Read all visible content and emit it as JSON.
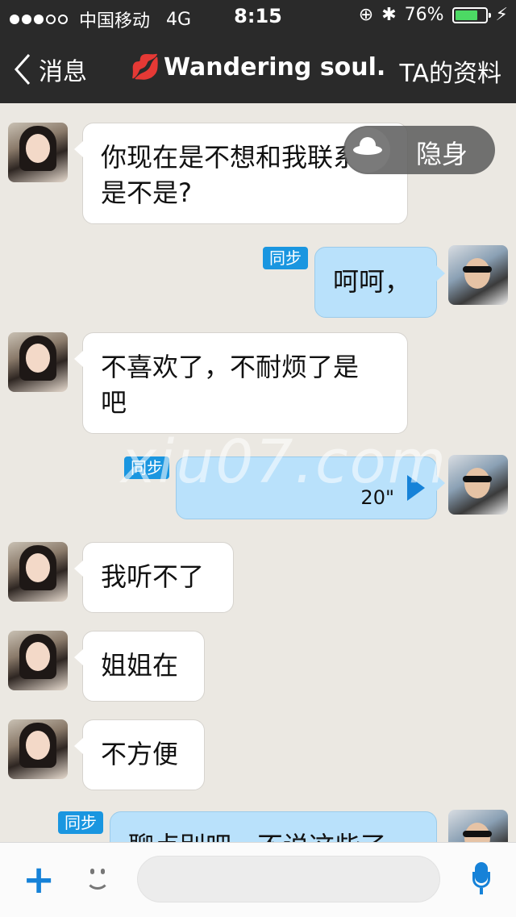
{
  "status_bar": {
    "carrier": "中国移动",
    "network": "4G",
    "time": "8:15",
    "battery": "76%",
    "battery_level": 0.76
  },
  "nav": {
    "back_label": "消息",
    "title": "Wandering soul.",
    "profile_link": "TA的资料"
  },
  "stealth_toast": {
    "label": "隐身"
  },
  "messages": [
    {
      "side": "in",
      "text": "你现在是不想和我联系了\n是不是?"
    },
    {
      "side": "out",
      "text": "呵呵，",
      "sync": "同步"
    },
    {
      "side": "in",
      "text": "不喜欢了，不耐烦了是\n吧"
    },
    {
      "side": "out",
      "voice_duration": "20\"",
      "sync": "同步"
    },
    {
      "side": "in",
      "text": "我听不了"
    },
    {
      "side": "in",
      "text": "姐姐在"
    },
    {
      "side": "in",
      "text": "不方便"
    },
    {
      "side": "out",
      "text": "聊点别吧，不说这些了",
      "sync": "同步"
    }
  ],
  "watermark": "xiu07.com",
  "input_bar": {
    "placeholder": ""
  },
  "colors": {
    "accent": "#1682d8",
    "outgoing_bubble": "#b9e1fb",
    "nav_bg": "#2a2a2a",
    "sync_badge": "#1a96e0"
  }
}
